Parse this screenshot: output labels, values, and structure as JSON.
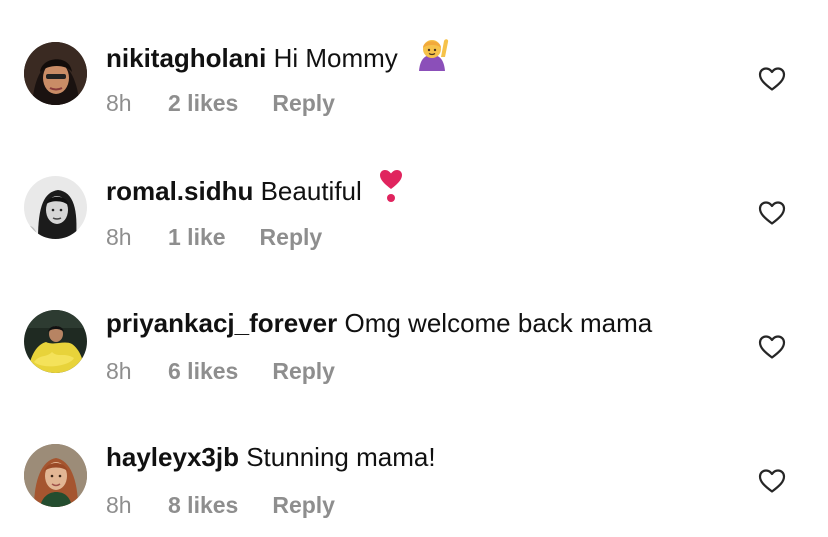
{
  "comments": [
    {
      "username": "nikitagholani",
      "text": "Hi Mommy",
      "emoji_icon": "person-raising-hand-emoji",
      "time": "8h",
      "likes": "2 likes",
      "reply": "Reply"
    },
    {
      "username": "romal.sidhu",
      "text": "Beautiful",
      "emoji_icon": "heart-exclamation-emoji",
      "time": "8h",
      "likes": "1 like",
      "reply": "Reply"
    },
    {
      "username": "priyankacj_forever",
      "text": "Omg welcome back mama",
      "emoji_icon": "",
      "time": "8h",
      "likes": "6 likes",
      "reply": "Reply"
    },
    {
      "username": "hayleyx3jb",
      "text": "Stunning mama!",
      "emoji_icon": "",
      "time": "8h",
      "likes": "8 likes",
      "reply": "Reply"
    }
  ],
  "icons": {
    "like": "heart-outline-icon"
  },
  "colors": {
    "text": "#111111",
    "meta": "#8e8e8e",
    "heart_stroke": "#262626",
    "emoji_heart": "#e0245e",
    "emoji_person": "#8b4fb9"
  }
}
